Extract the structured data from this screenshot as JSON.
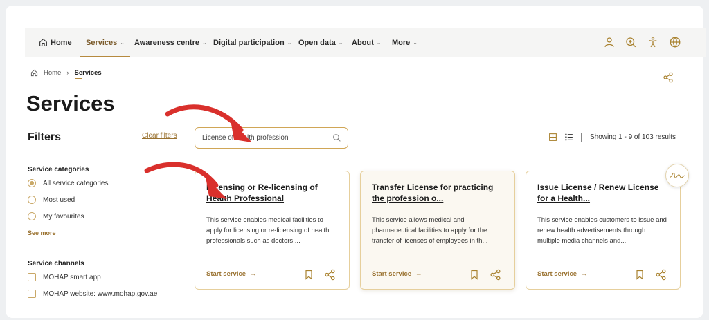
{
  "nav": {
    "items": [
      {
        "label": "Home",
        "icon": "home-icon"
      },
      {
        "label": "Services",
        "active": true
      },
      {
        "label": "Awareness centre"
      },
      {
        "label": "Digital participation"
      },
      {
        "label": "Open data"
      },
      {
        "label": "About"
      },
      {
        "label": "More"
      }
    ],
    "right_icons": [
      "user-icon",
      "zoom-icon",
      "accessibility-icon",
      "globe-icon"
    ]
  },
  "breadcrumb": {
    "home": "Home",
    "current": "Services"
  },
  "page_title": "Services",
  "filters": {
    "title": "Filters",
    "clear": "Clear filters",
    "categories_title": "Service categories",
    "categories": [
      "All service categories",
      "Most used",
      "My favourites"
    ],
    "selected_category": "All service categories",
    "see_more": "See more",
    "channels_title": "Service channels",
    "channels": [
      "MOHAP smart app",
      "MOHAP website: www.mohap.gov.ae"
    ]
  },
  "search": {
    "value": "License of health profession"
  },
  "results_text": "Showing 1 - 9 of 103 results",
  "cards": [
    {
      "title": "Licensing or Re-licensing of Health Professional",
      "description": "This service enables medical facilities to apply for licensing or re-licensing of health professionals such as doctors,...",
      "action": "Start service"
    },
    {
      "title": "Transfer License for practicing the profession o...",
      "description": "This service allows medical and pharmaceutical facilities to apply for the transfer of licenses of employees in th...",
      "action": "Start service"
    },
    {
      "title": "Issue License / Renew License for a Health...",
      "description": "This service enables customers to issue and renew health advertisements through multiple media channels and...",
      "action": "Start service"
    }
  ],
  "colors": {
    "accent": "#b68a3e",
    "annotation_arrow": "#d9302c"
  }
}
